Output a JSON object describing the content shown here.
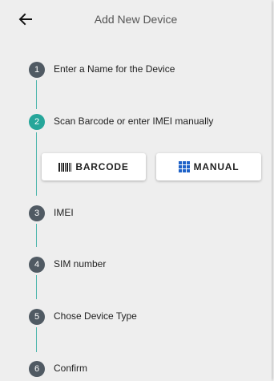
{
  "header": {
    "title": "Add New Device"
  },
  "icons": {
    "back": "arrow-left-icon",
    "barcode": "barcode-icon",
    "manual": "keypad-grid-icon"
  },
  "colors": {
    "active_step": "#26a69a",
    "inactive_step": "#505a63",
    "connector": "#4db6ac",
    "manual_icon": "#1e62c8"
  },
  "steps": [
    {
      "number": "1",
      "label": "Enter a Name for the Device"
    },
    {
      "number": "2",
      "label": "Scan Barcode or enter IMEI manually"
    },
    {
      "number": "3",
      "label": "IMEI"
    },
    {
      "number": "4",
      "label": "SIM number"
    },
    {
      "number": "5",
      "label": "Chose Device Type"
    },
    {
      "number": "6",
      "label": "Confirm"
    }
  ],
  "active_step": 2,
  "buttons": {
    "barcode": "BARCODE",
    "manual": "MANUAL"
  }
}
